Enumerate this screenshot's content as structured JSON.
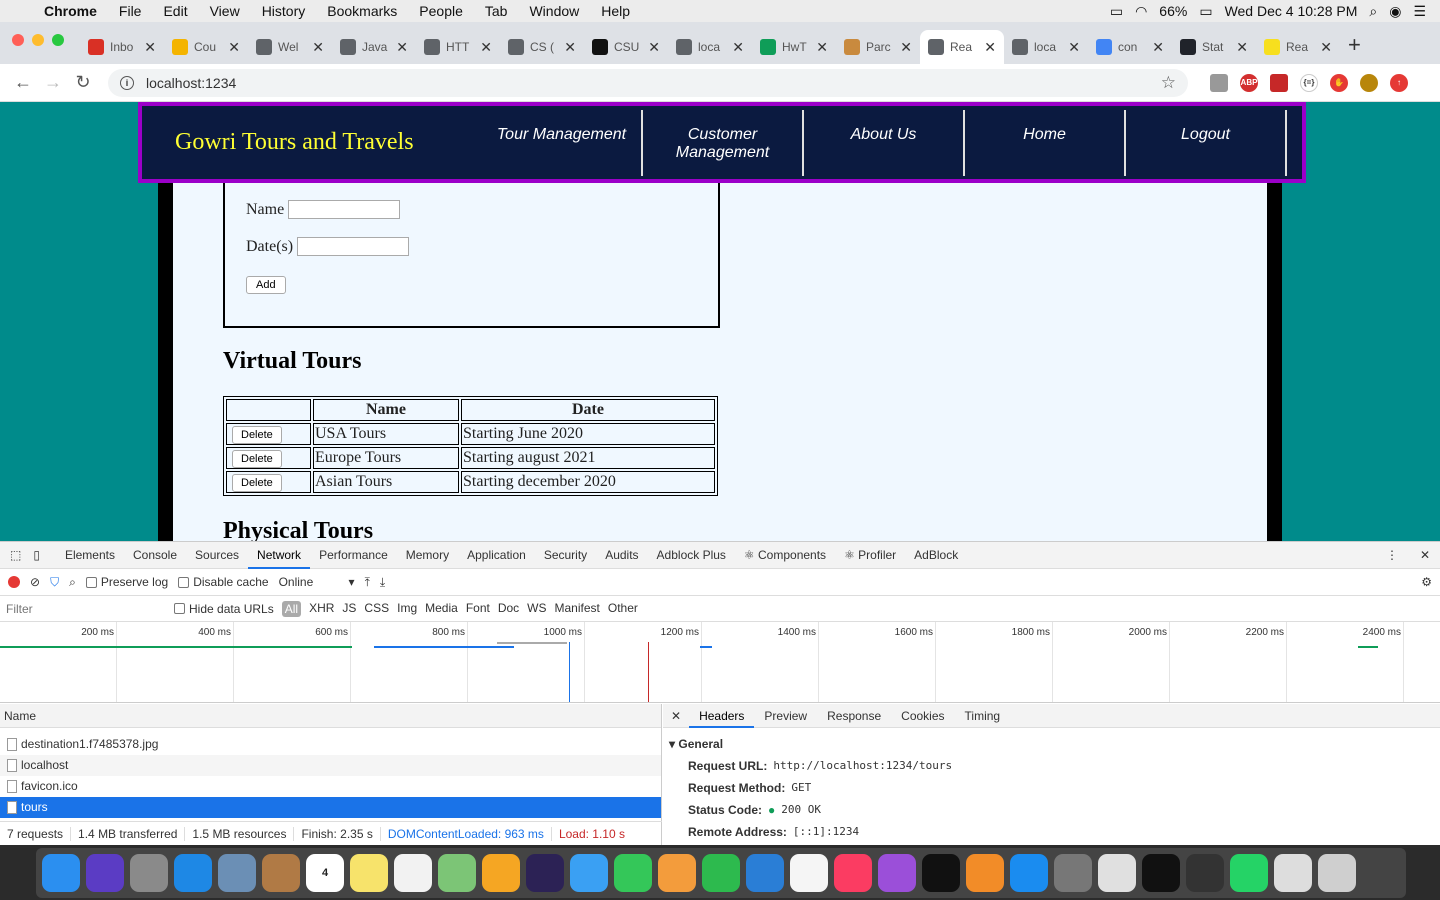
{
  "menubar": {
    "app": "Chrome",
    "items": [
      "File",
      "Edit",
      "View",
      "History",
      "Bookmarks",
      "People",
      "Tab",
      "Window",
      "Help"
    ],
    "battery": "66%",
    "clock": "Wed Dec 4  10:28 PM"
  },
  "tabs": [
    {
      "title": "Inbo",
      "favicon": "gmail-icon",
      "color": "#d93025"
    },
    {
      "title": "Cou",
      "favicon": "docs-icon",
      "color": "#f4b400"
    },
    {
      "title": "Wel",
      "favicon": "globe-icon",
      "color": "#5f6368"
    },
    {
      "title": "Java",
      "favicon": "globe-icon",
      "color": "#5f6368"
    },
    {
      "title": "HTT",
      "favicon": "globe-icon",
      "color": "#5f6368"
    },
    {
      "title": "CS (",
      "favicon": "globe-icon",
      "color": "#5f6368"
    },
    {
      "title": "CSU",
      "favicon": "github-icon",
      "color": "#111111"
    },
    {
      "title": "loca",
      "favicon": "globe-icon",
      "color": "#5f6368"
    },
    {
      "title": "HwT",
      "favicon": "drive-icon",
      "color": "#0f9d58"
    },
    {
      "title": "Parc",
      "favicon": "parcel-icon",
      "color": "#c98a3e"
    },
    {
      "title": "Rea",
      "favicon": "globe-icon",
      "color": "#5f6368",
      "active": true
    },
    {
      "title": "loca",
      "favicon": "globe-icon",
      "color": "#5f6368"
    },
    {
      "title": "con",
      "favicon": "google-icon",
      "color": "#4285f4"
    },
    {
      "title": "Stat",
      "favicon": "react-icon",
      "color": "#20232a"
    },
    {
      "title": "Rea",
      "favicon": "js-icon",
      "color": "#f7df1e"
    }
  ],
  "address": {
    "url": "localhost:1234"
  },
  "site": {
    "brand": "Gowri Tours and Travels",
    "nav": [
      "Tour Management",
      "Customer Management",
      "About Us",
      "Home",
      "Logout"
    ],
    "form": {
      "name_label": "Name",
      "dates_label": "Date(s)",
      "add_label": "Add"
    },
    "virtual_heading": "Virtual Tours",
    "physical_heading": "Physical Tours",
    "table": {
      "headers": [
        "",
        "Name",
        "Date"
      ],
      "delete_label": "Delete",
      "rows": [
        {
          "name": "USA Tours",
          "date": "Starting June 2020"
        },
        {
          "name": "Europe Tours",
          "date": "Starting august 2021"
        },
        {
          "name": "Asian Tours",
          "date": "Starting december 2020"
        }
      ]
    }
  },
  "devtools": {
    "tabs": [
      "Elements",
      "Console",
      "Sources",
      "Network",
      "Performance",
      "Memory",
      "Application",
      "Security",
      "Audits",
      "Adblock Plus",
      "⚛ Components",
      "⚛ Profiler",
      "AdBlock"
    ],
    "active_tab": "Network",
    "preserve_log": "Preserve log",
    "disable_cache": "Disable cache",
    "throttle": "Online",
    "filter_placeholder": "Filter",
    "hide_data_urls": "Hide data URLs",
    "types": [
      "All",
      "XHR",
      "JS",
      "CSS",
      "Img",
      "Media",
      "Font",
      "Doc",
      "WS",
      "Manifest",
      "Other"
    ],
    "timeline_ticks": [
      "200 ms",
      "400 ms",
      "600 ms",
      "800 ms",
      "1000 ms",
      "1200 ms",
      "1400 ms",
      "1600 ms",
      "1800 ms",
      "2000 ms",
      "2200 ms",
      "2400 ms"
    ],
    "name_header": "Name",
    "requests": [
      {
        "name": "destination1.f7485378.jpg"
      },
      {
        "name": "localhost"
      },
      {
        "name": "favicon.ico"
      },
      {
        "name": "tours",
        "selected": true
      }
    ],
    "summary": {
      "requests": "7 requests",
      "transferred": "1.4 MB transferred",
      "resources": "1.5 MB resources",
      "finish": "Finish: 2.35 s",
      "dcl": "DOMContentLoaded: 963 ms",
      "load": "Load: 1.10 s"
    },
    "detail_tabs": [
      "Headers",
      "Preview",
      "Response",
      "Cookies",
      "Timing"
    ],
    "general": {
      "title": "General",
      "url_label": "Request URL:",
      "url": "http://localhost:1234/tours",
      "method_label": "Request Method:",
      "method": "GET",
      "status_label": "Status Code:",
      "status": "200 OK",
      "remote_label": "Remote Address:",
      "remote": "[::1]:1234"
    }
  },
  "dock": {
    "icons": [
      {
        "name": "finder-icon",
        "color": "#2b8ff0"
      },
      {
        "name": "siri-icon",
        "color": "#5b3cc4"
      },
      {
        "name": "launchpad-icon",
        "color": "#8a8a8a"
      },
      {
        "name": "safari-icon",
        "color": "#1e88e5"
      },
      {
        "name": "preview-icon",
        "color": "#6b8fb5"
      },
      {
        "name": "contacts-icon",
        "color": "#b07a45"
      },
      {
        "name": "calendar-icon",
        "color": "#ffffff",
        "text": "4"
      },
      {
        "name": "notes-icon",
        "color": "#f7e36b"
      },
      {
        "name": "reminders-icon",
        "color": "#f2f2f2"
      },
      {
        "name": "maps-icon",
        "color": "#7cc576"
      },
      {
        "name": "photos-icon",
        "color": "#f5a623"
      },
      {
        "name": "eclipse-icon",
        "color": "#2c2255"
      },
      {
        "name": "messages-icon",
        "color": "#3aa0f3"
      },
      {
        "name": "facetime-icon",
        "color": "#34c759"
      },
      {
        "name": "pages-icon",
        "color": "#f39c3c"
      },
      {
        "name": "numbers-icon",
        "color": "#2dba4e"
      },
      {
        "name": "keynote-icon",
        "color": "#2a7ed6"
      },
      {
        "name": "news-icon",
        "color": "#f5f5f5"
      },
      {
        "name": "music-icon",
        "color": "#fb3c62"
      },
      {
        "name": "podcasts-icon",
        "color": "#9b4fd9"
      },
      {
        "name": "tv-icon",
        "color": "#111111"
      },
      {
        "name": "books-icon",
        "color": "#f28c28"
      },
      {
        "name": "app-store-icon",
        "color": "#1a8cf0"
      },
      {
        "name": "system-preferences-icon",
        "color": "#777777"
      },
      {
        "name": "chrome-icon",
        "color": "#e0e0e0"
      },
      {
        "name": "terminal-icon",
        "color": "#111111"
      },
      {
        "name": "sublime-icon",
        "color": "#333333"
      },
      {
        "name": "whatsapp-icon",
        "color": "#25d366"
      },
      {
        "name": "archive-icon",
        "color": "#dddddd"
      },
      {
        "name": "trash-icon",
        "color": "#cfcfcf"
      }
    ]
  }
}
